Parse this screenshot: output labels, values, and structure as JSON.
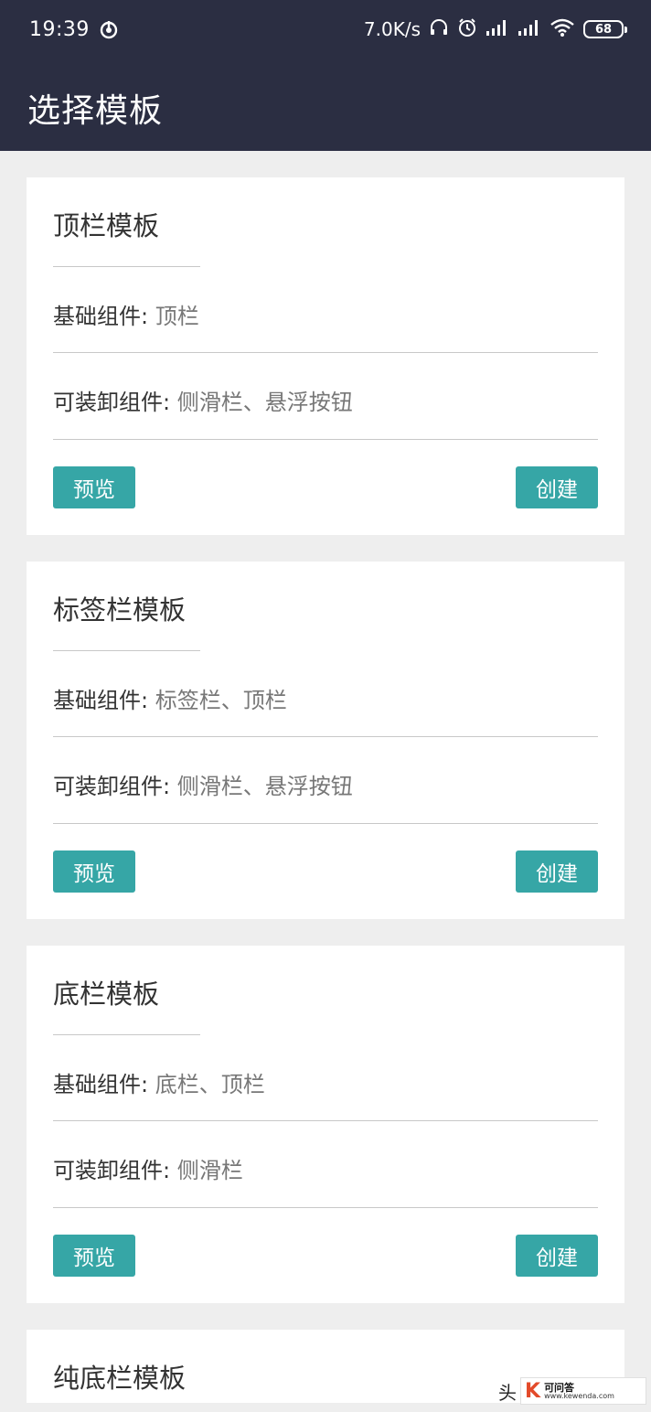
{
  "status_bar": {
    "time": "19:39",
    "network_speed": "7.0K/s",
    "battery_level": "68",
    "icons": [
      "nfc-icon",
      "headset-icon",
      "alarm-icon",
      "signal-icon",
      "signal-icon",
      "wifi-icon",
      "battery-icon"
    ]
  },
  "header": {
    "title": "选择模板"
  },
  "cards": [
    {
      "title": "顶栏模板",
      "base_label": "基础组件:",
      "base_value": "顶栏",
      "optional_label": "可装卸组件:",
      "optional_value": "侧滑栏、悬浮按钮",
      "preview_label": "预览",
      "create_label": "创建"
    },
    {
      "title": "标签栏模板",
      "base_label": "基础组件:",
      "base_value": "标签栏、顶栏",
      "optional_label": "可装卸组件:",
      "optional_value": "侧滑栏、悬浮按钮",
      "preview_label": "预览",
      "create_label": "创建"
    },
    {
      "title": "底栏模板",
      "base_label": "基础组件:",
      "base_value": "底栏、顶栏",
      "optional_label": "可装卸组件:",
      "optional_value": "侧滑栏",
      "preview_label": "预览",
      "create_label": "创建"
    },
    {
      "title": "纯底栏模板"
    }
  ],
  "watermark": {
    "char": "头",
    "logo_letter": "K",
    "name": "可问答",
    "url": "www.kewenda.com"
  },
  "colors": {
    "header_bg": "#2b2e42",
    "page_bg": "#eeeeee",
    "button_bg": "#36a6a6"
  }
}
